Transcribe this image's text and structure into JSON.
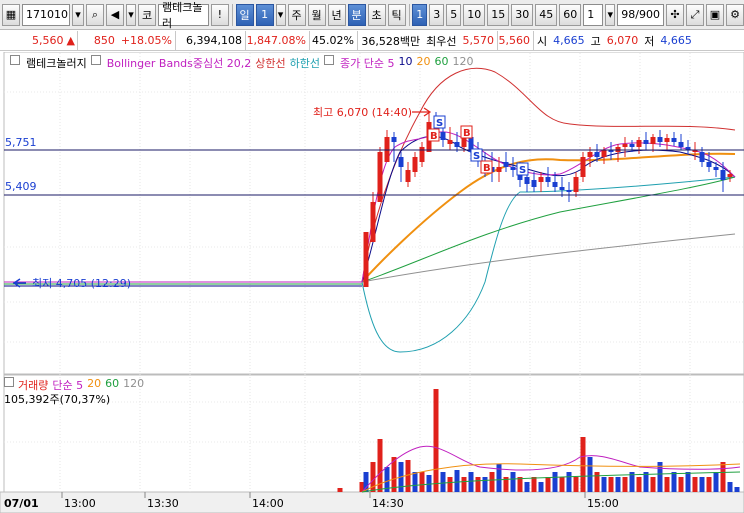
{
  "toolbar": {
    "code": "171010",
    "market_btn": "코",
    "stock_name": "램테크놀러",
    "exclaim_btn": "!",
    "period_buttons": [
      "일",
      "1",
      "주",
      "월",
      "년",
      "분",
      "초",
      "틱"
    ],
    "interval_buttons": [
      "1",
      "3",
      "5",
      "10",
      "15",
      "30",
      "45",
      "60"
    ],
    "count_value": "1",
    "range_value": "98/900"
  },
  "quote": {
    "price": "5,560",
    "change_arrow": "▲",
    "change": "850",
    "change_pct": "+18.05%",
    "volume": "6,394,108",
    "volume_ratio": "1,847.08%",
    "turnover": "45.02%",
    "amount": "36,528백만",
    "best_ask_label": "최우선",
    "best_ask": "5,570",
    "best_bid": "5,560",
    "open_label": "시",
    "open": "4,665",
    "high_label": "고",
    "high": "6,070",
    "low_label": "저",
    "low": "4,665"
  },
  "legend": {
    "name": "램테크놀러지",
    "bollinger": "Bollinger Bands중심선 20,2",
    "upper": "상한선",
    "lower": "하한선",
    "ma_label": "종가 단순 5",
    "ma10": "10",
    "ma20": "20",
    "ma60": "60",
    "ma120": "120"
  },
  "price_chart": {
    "line_levels": [
      "5,751",
      "5,409"
    ],
    "max_marker": "최고 6,070 (14:40)",
    "min_marker": "최저 4,705 (12:29)"
  },
  "volume_chart": {
    "legend_label": "거래량",
    "ma_label": "단순 5",
    "ma20": "20",
    "ma60": "60",
    "ma120": "120",
    "current": "105,392주(70,37%)"
  },
  "time_axis": {
    "date": "07/01",
    "ticks": [
      "13:00",
      "13:30",
      "14:00",
      "14:30",
      "15:00"
    ]
  },
  "colors": {
    "up": "#e0211b",
    "down": "#1a3fd1",
    "ma5": "#c020c0",
    "ma10": "#0a0a8a",
    "ma20": "#f09010",
    "ma60": "#20a040",
    "ma120": "#909090",
    "bb_upper": "#d03030",
    "bb_lower": "#20a0b0"
  }
}
